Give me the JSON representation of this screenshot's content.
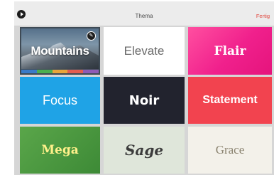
{
  "topbar": {
    "play_icon": "play-circle-icon",
    "title": "Thema",
    "done_label": "Fertig",
    "done_color": "#e0443b"
  },
  "themes": {
    "mountains": {
      "label": "Mountains",
      "selected": true,
      "edit_icon": "pencil-icon",
      "palette": [
        "#3a7bc8",
        "#4caf50",
        "#e9a53a",
        "#e35d4f",
        "#8e5bb5"
      ]
    },
    "elevate": {
      "label": "Elevate",
      "background": "#ffffff"
    },
    "flair": {
      "label": "Flair",
      "background": "#f0208c"
    },
    "focus": {
      "label": "Focus",
      "background": "#1fa3e6"
    },
    "noir": {
      "label": "Noir",
      "background": "#22232e"
    },
    "statement": {
      "label": "Statement",
      "background": "#f2434f"
    },
    "mega": {
      "label": "Mega",
      "background": "#3d8a36"
    },
    "sage": {
      "label": "Sage",
      "background": "#dfe6da"
    },
    "grace": {
      "label": "Grace",
      "background": "#f3f1ea"
    }
  }
}
